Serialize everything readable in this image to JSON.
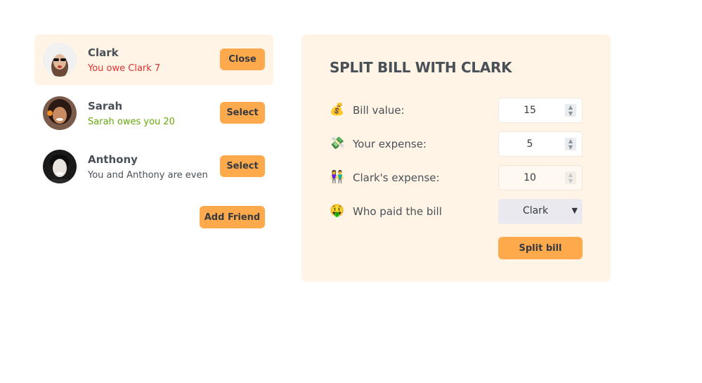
{
  "friends": [
    {
      "name": "Clark",
      "status": "You owe Clark 7",
      "status_type": "owe",
      "button": "Close",
      "selected": true
    },
    {
      "name": "Sarah",
      "status": "Sarah owes you 20",
      "status_type": "owed",
      "button": "Select",
      "selected": false
    },
    {
      "name": "Anthony",
      "status": "You and Anthony are even",
      "status_type": "even",
      "button": "Select",
      "selected": false
    }
  ],
  "add_friend_label": "Add Friend",
  "split_form": {
    "title": "SPLIT BILL WITH CLARK",
    "bill_value": {
      "emoji": "💰",
      "label": "Bill value:",
      "value": "15"
    },
    "your_expense": {
      "emoji": "💸",
      "label": "Your expense:",
      "value": "5"
    },
    "friend_expense": {
      "emoji": "👫",
      "label": "Clark's expense:",
      "value": "10"
    },
    "who_paid": {
      "emoji": "🤑",
      "label": "Who paid the bill",
      "selected": "Clark"
    },
    "submit_label": "Split bill"
  },
  "colors": {
    "accent": "#ffa94d",
    "panel_bg": "#fff4e6",
    "owe_red": "#e03131",
    "owed_green": "#66a80f"
  }
}
